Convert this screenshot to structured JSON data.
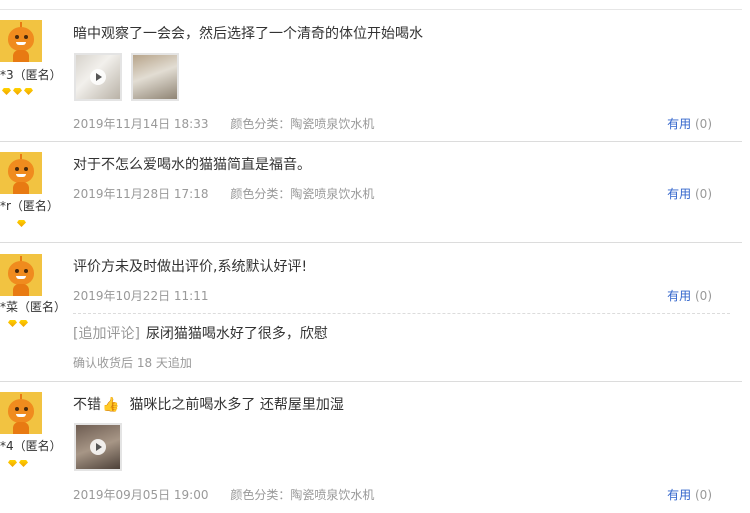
{
  "reviews": [
    {
      "user": "*3（匿名）",
      "gem_count": 3,
      "content": "暗中观察了一会会，然后选择了一个清奇的体位开始喝水",
      "photos": 2,
      "date": "2019年11月14日 18:33",
      "sku": "颜色分类：陶瓷喷泉饮水机",
      "useful_label": "有用",
      "useful_count": "(0)"
    },
    {
      "user": "*r（匿名）",
      "gem_count": 1,
      "content": "对于不怎么爱喝水的猫猫简直是福音。",
      "date": "2019年11月28日 17:18",
      "sku": "颜色分类：陶瓷喷泉饮水机",
      "useful_label": "有用",
      "useful_count": "(0)"
    },
    {
      "user": "*菜（匿名）",
      "gem_count": 2,
      "content": "评价方未及时做出评价,系统默认好评!",
      "date": "2019年10月22日 11:11",
      "useful_label": "有用",
      "useful_count": "(0)",
      "append": {
        "tag": "[追加评论]",
        "content": "尿闭猫猫喝水好了很多，欣慰",
        "days": "确认收货后 18 天追加"
      }
    },
    {
      "user": "*4（匿名）",
      "gem_count": 2,
      "content_before": "不错",
      "content_emoji": "👍",
      "content_after": "猫咪比之前喝水多了 还帮屋里加湿",
      "photos": 1,
      "date": "2019年09月05日 19:00",
      "sku": "颜色分类：陶瓷喷泉饮水机",
      "useful_label": "有用",
      "useful_count": "(0)"
    }
  ]
}
